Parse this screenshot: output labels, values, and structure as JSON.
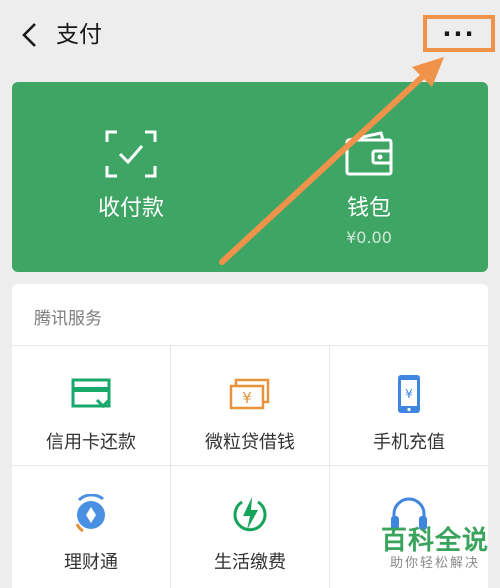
{
  "header": {
    "title": "支付",
    "more_label": "···",
    "back_icon": "chevron-left-icon"
  },
  "wallet_card": {
    "background": "#3fa564",
    "receive_pay": {
      "label": "收付款",
      "icon": "scan-check-icon"
    },
    "wallet": {
      "label": "钱包",
      "balance": "¥0.00",
      "icon": "wallet-icon"
    }
  },
  "services": {
    "section_title": "腾讯服务",
    "items": [
      {
        "label": "信用卡还款",
        "icon": "credit-card-icon",
        "color": "#18a86c"
      },
      {
        "label": "微粒贷借钱",
        "icon": "banknotes-icon",
        "color": "#e8933c"
      },
      {
        "label": "手机充值",
        "icon": "mobile-topup-icon",
        "color": "#3f86e0"
      },
      {
        "label": "理财通",
        "icon": "wealth-icon",
        "color": "#4a90e2"
      },
      {
        "label": "生活缴费",
        "icon": "lightning-icon",
        "color": "#16a35a"
      },
      {
        "label": "",
        "icon": "headset-icon",
        "color": "#3f86e0"
      }
    ]
  },
  "annotation": {
    "color": "#f0934a"
  },
  "watermark": {
    "title": "百科全说",
    "subtitle": "助你轻松解决"
  }
}
